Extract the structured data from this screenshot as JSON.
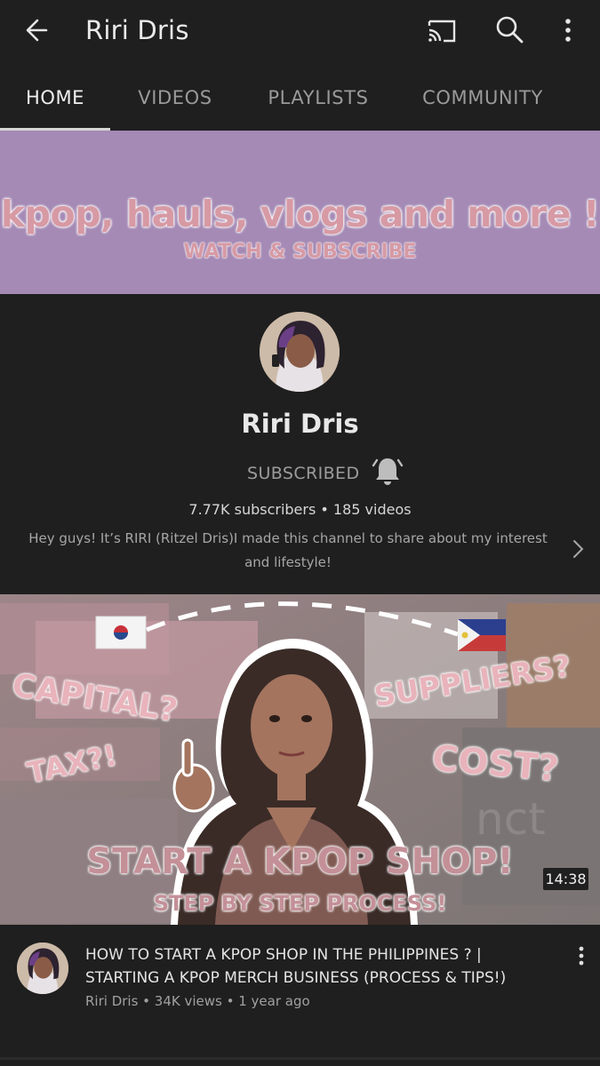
{
  "appbar": {
    "title": "Riri Dris",
    "icons": [
      "back-arrow-icon",
      "cast-icon",
      "search-icon",
      "more-vert-icon"
    ]
  },
  "tabs": [
    {
      "label": "HOME",
      "active": true
    },
    {
      "label": "VIDEOS",
      "active": false
    },
    {
      "label": "PLAYLISTS",
      "active": false
    },
    {
      "label": "COMMUNITY",
      "active": false
    }
  ],
  "banner": {
    "headline": "kpop, hauls, vlogs and more !",
    "subline": "WATCH & SUBSCRIBE",
    "background_color": "#a48ab5"
  },
  "channel": {
    "name": "Riri Dris",
    "subscribe_state": "SUBSCRIBED",
    "stats": "7.77K subscribers • 185 videos",
    "description": "Hey guys! It’s RIRI (Ritzel Dris)I made this channel to share about my interest and lifestyle!"
  },
  "featured_video": {
    "thumbnail_text": {
      "capital": "CAPITAL?",
      "suppliers": "SUPPLIERS?",
      "tax": "TAX?!",
      "cost": "COST?",
      "main": "START A KPOP SHOP!",
      "sub": "STEP BY STEP PROCESS!"
    },
    "duration": "14:38",
    "title": "HOW TO START A KPOP SHOP IN THE PHILIPPINES ? | STARTING A KPOP MERCH BUSINESS (PROCESS & TIPS!)",
    "meta": "Riri Dris • 34K views • 1 year ago"
  }
}
